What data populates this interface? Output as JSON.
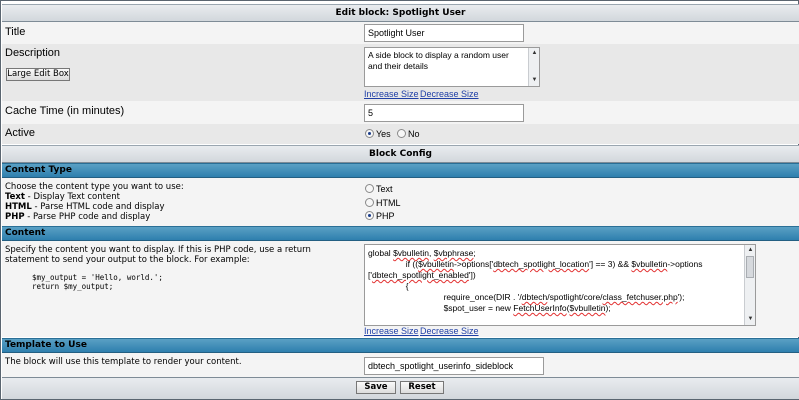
{
  "header": {
    "title": "Edit block: Spotlight User"
  },
  "title_row": {
    "label": "Title",
    "value": "Spotlight User"
  },
  "description_row": {
    "label": "Description",
    "large_edit_button": "Large Edit Box",
    "value": "A side block to display a random user and their details",
    "increase_size": "Increase Size",
    "decrease_size": "Decrease Size"
  },
  "cache_row": {
    "label": "Cache Time (in minutes)",
    "value": "5"
  },
  "active_row": {
    "label": "Active",
    "yes": "Yes",
    "no": "No",
    "selected": "Yes"
  },
  "block_config": {
    "title": "Block Config"
  },
  "content_type": {
    "section_title": "Content Type",
    "intro": "Choose the content type you want to use:",
    "items": [
      {
        "name": "Text",
        "desc": " - Display Text content"
      },
      {
        "name": "HTML",
        "desc": " - Parse HTML code and display"
      },
      {
        "name": "PHP",
        "desc": " - Parse PHP code and display"
      }
    ],
    "options": [
      "Text",
      "HTML",
      "PHP"
    ],
    "selected": "PHP"
  },
  "content": {
    "section_title": "Content",
    "description": "Specify the content you want to display. If this is PHP code, use a return statement to send your output to the block. For example:",
    "example_line1": "$my_output = 'Hello, world.';",
    "example_line2": "return $my_output;",
    "code_lines": [
      "global $vbulletin, $vbphrase;",
      "",
      "                if (($vbulletin->options['dbtech_spotlight_location'] == 3) && $vbulletin->options",
      "['dbtech_spotlight_enabled'])",
      "                {",
      "                                require_once(DIR . '/dbtech/spotlight/core/class_fetchuser.php');",
      "",
      "                                $spot_user = new FetchUserInfo($vbulletin);"
    ],
    "increase_size": "Increase Size",
    "decrease_size": "Decrease Size"
  },
  "template": {
    "section_title": "Template to Use",
    "description": "The block will use this template to render your content.",
    "value": "dbtech_spotlight_userinfo_sideblock"
  },
  "buttons": {
    "save": "Save",
    "reset": "Reset"
  }
}
